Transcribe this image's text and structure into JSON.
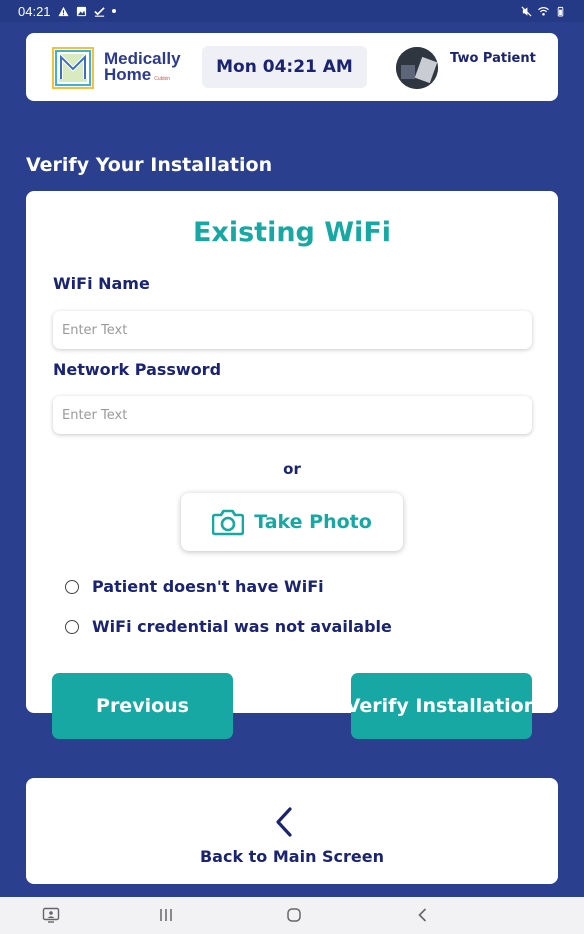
{
  "status_bar": {
    "time": "04:21"
  },
  "header": {
    "brand_line1": "Medically",
    "brand_line2": "Home",
    "brand_suffix": "Cubbin",
    "datetime": "Mon 04:21 AM",
    "patient_name": "Two Patient"
  },
  "page": {
    "title": "Verify Your Installation"
  },
  "form": {
    "heading": "Existing WiFi",
    "wifi_label": "WiFi Name",
    "wifi_placeholder": "Enter Text",
    "wifi_value": "",
    "password_label": "Network Password",
    "password_placeholder": "Enter Text",
    "password_value": "",
    "or_text": "or",
    "photo_button": "Take Photo",
    "options": [
      {
        "label": "Patient doesn't have WiFi",
        "selected": false
      },
      {
        "label": "WiFi credential was not available",
        "selected": false
      }
    ]
  },
  "buttons": {
    "previous": "Previous",
    "verify": "Verify Installation"
  },
  "back": {
    "label": "Back to Main Screen"
  },
  "colors": {
    "background": "#2b3f8f",
    "teal": "#17a8a3",
    "navy": "#1a2470"
  }
}
